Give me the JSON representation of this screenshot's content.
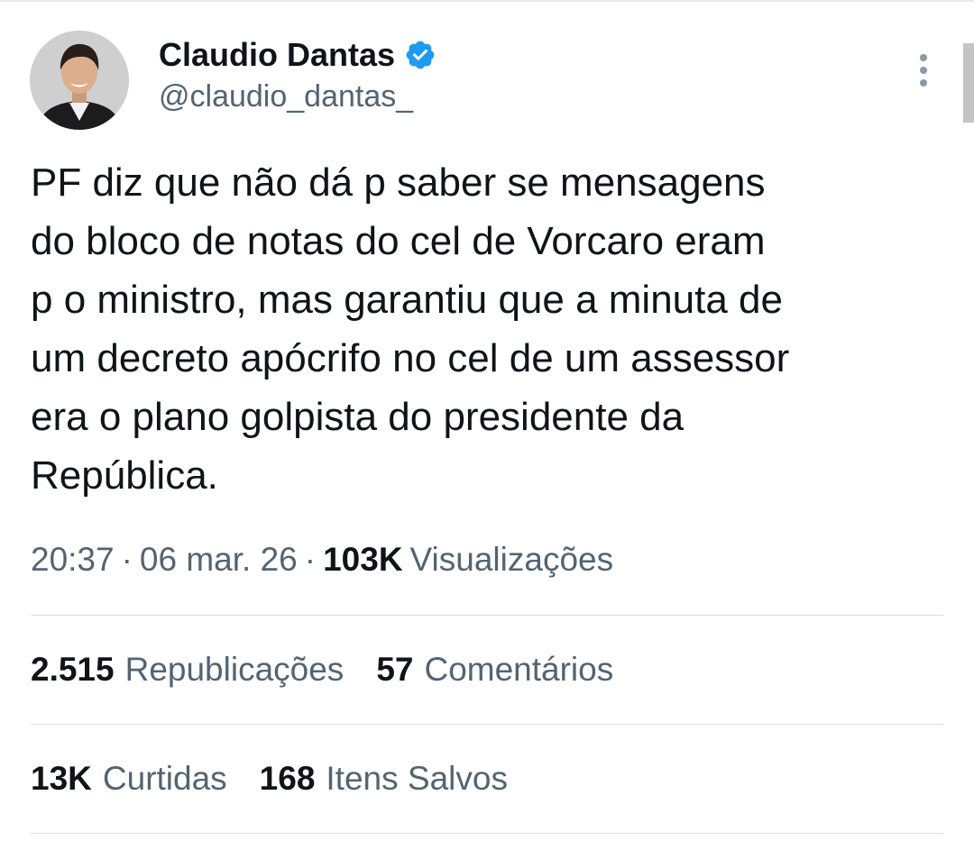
{
  "author": {
    "display_name": "Claudio Dantas",
    "handle": "@claudio_dantas_",
    "verified_icon": "verified-badge-icon",
    "avatar": "avatar-photo"
  },
  "tweet": {
    "text": "PF diz que não dá p saber se mensagens\ndo bloco de notas do cel de Vorcaro eram\np o ministro, mas garantiu que a minuta de\num decreto apócrifo no cel de um assessor\nera o plano golpista do presidente da\nRepública."
  },
  "meta": {
    "time": "20:37",
    "separator": "·",
    "date": "06 mar. 26",
    "views_count": "103K",
    "views_label": "Visualizações"
  },
  "stats": {
    "reposts_count": "2.515",
    "reposts_label": "Republicações",
    "comments_count": "57",
    "comments_label": "Comentários",
    "likes_count": "13K",
    "likes_label": "Curtidas",
    "saves_count": "168",
    "saves_label": "Itens Salvos"
  },
  "colors": {
    "text_primary": "#0f1419",
    "text_secondary": "#536471",
    "verified_blue": "#1d9bf0",
    "divider": "#dcdfe2"
  },
  "icons": {
    "more": "more-vertical-icon"
  }
}
